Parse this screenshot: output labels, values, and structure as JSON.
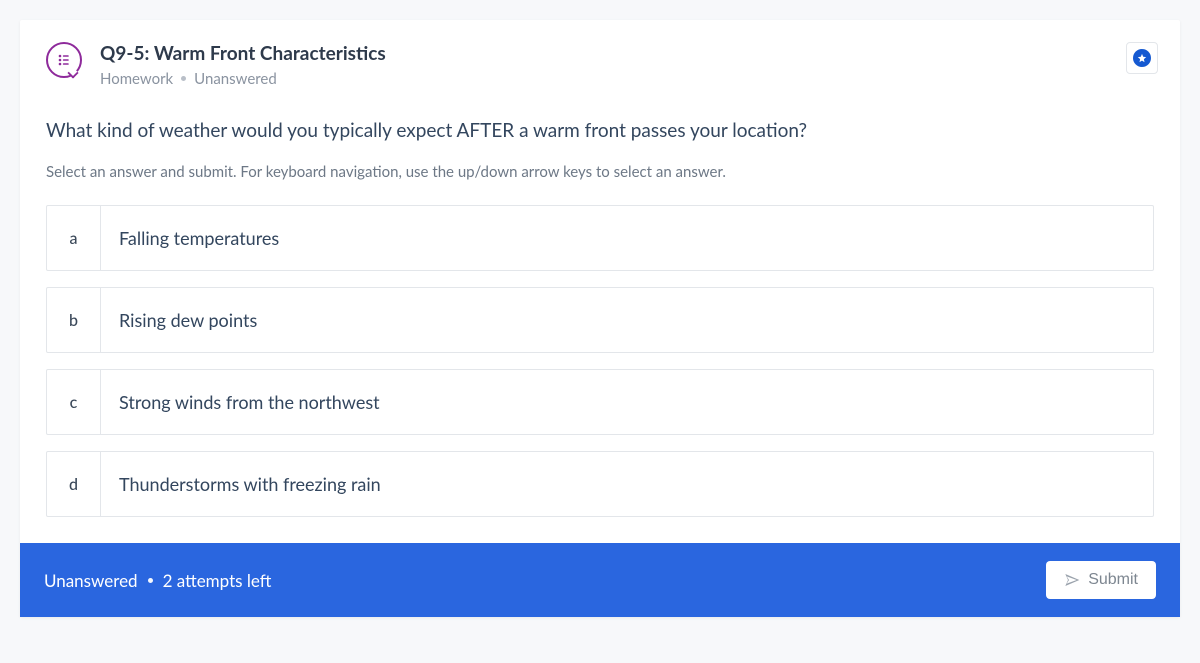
{
  "header": {
    "title": "Q9-5: Warm Front Characteristics",
    "category": "Homework",
    "status": "Unanswered"
  },
  "prompt_text": "What kind of weather would you typically expect AFTER a warm front passes your location?",
  "helper_text": "Select an answer and submit. For keyboard navigation, use the up/down arrow keys to select an answer.",
  "options": [
    {
      "letter": "a",
      "text": "Falling temperatures"
    },
    {
      "letter": "b",
      "text": "Rising dew points"
    },
    {
      "letter": "c",
      "text": "Strong winds from the northwest"
    },
    {
      "letter": "d",
      "text": "Thunderstorms with freezing rain"
    }
  ],
  "footer": {
    "status": "Unanswered",
    "attempts": "2 attempts left",
    "submit_label": "Submit"
  }
}
